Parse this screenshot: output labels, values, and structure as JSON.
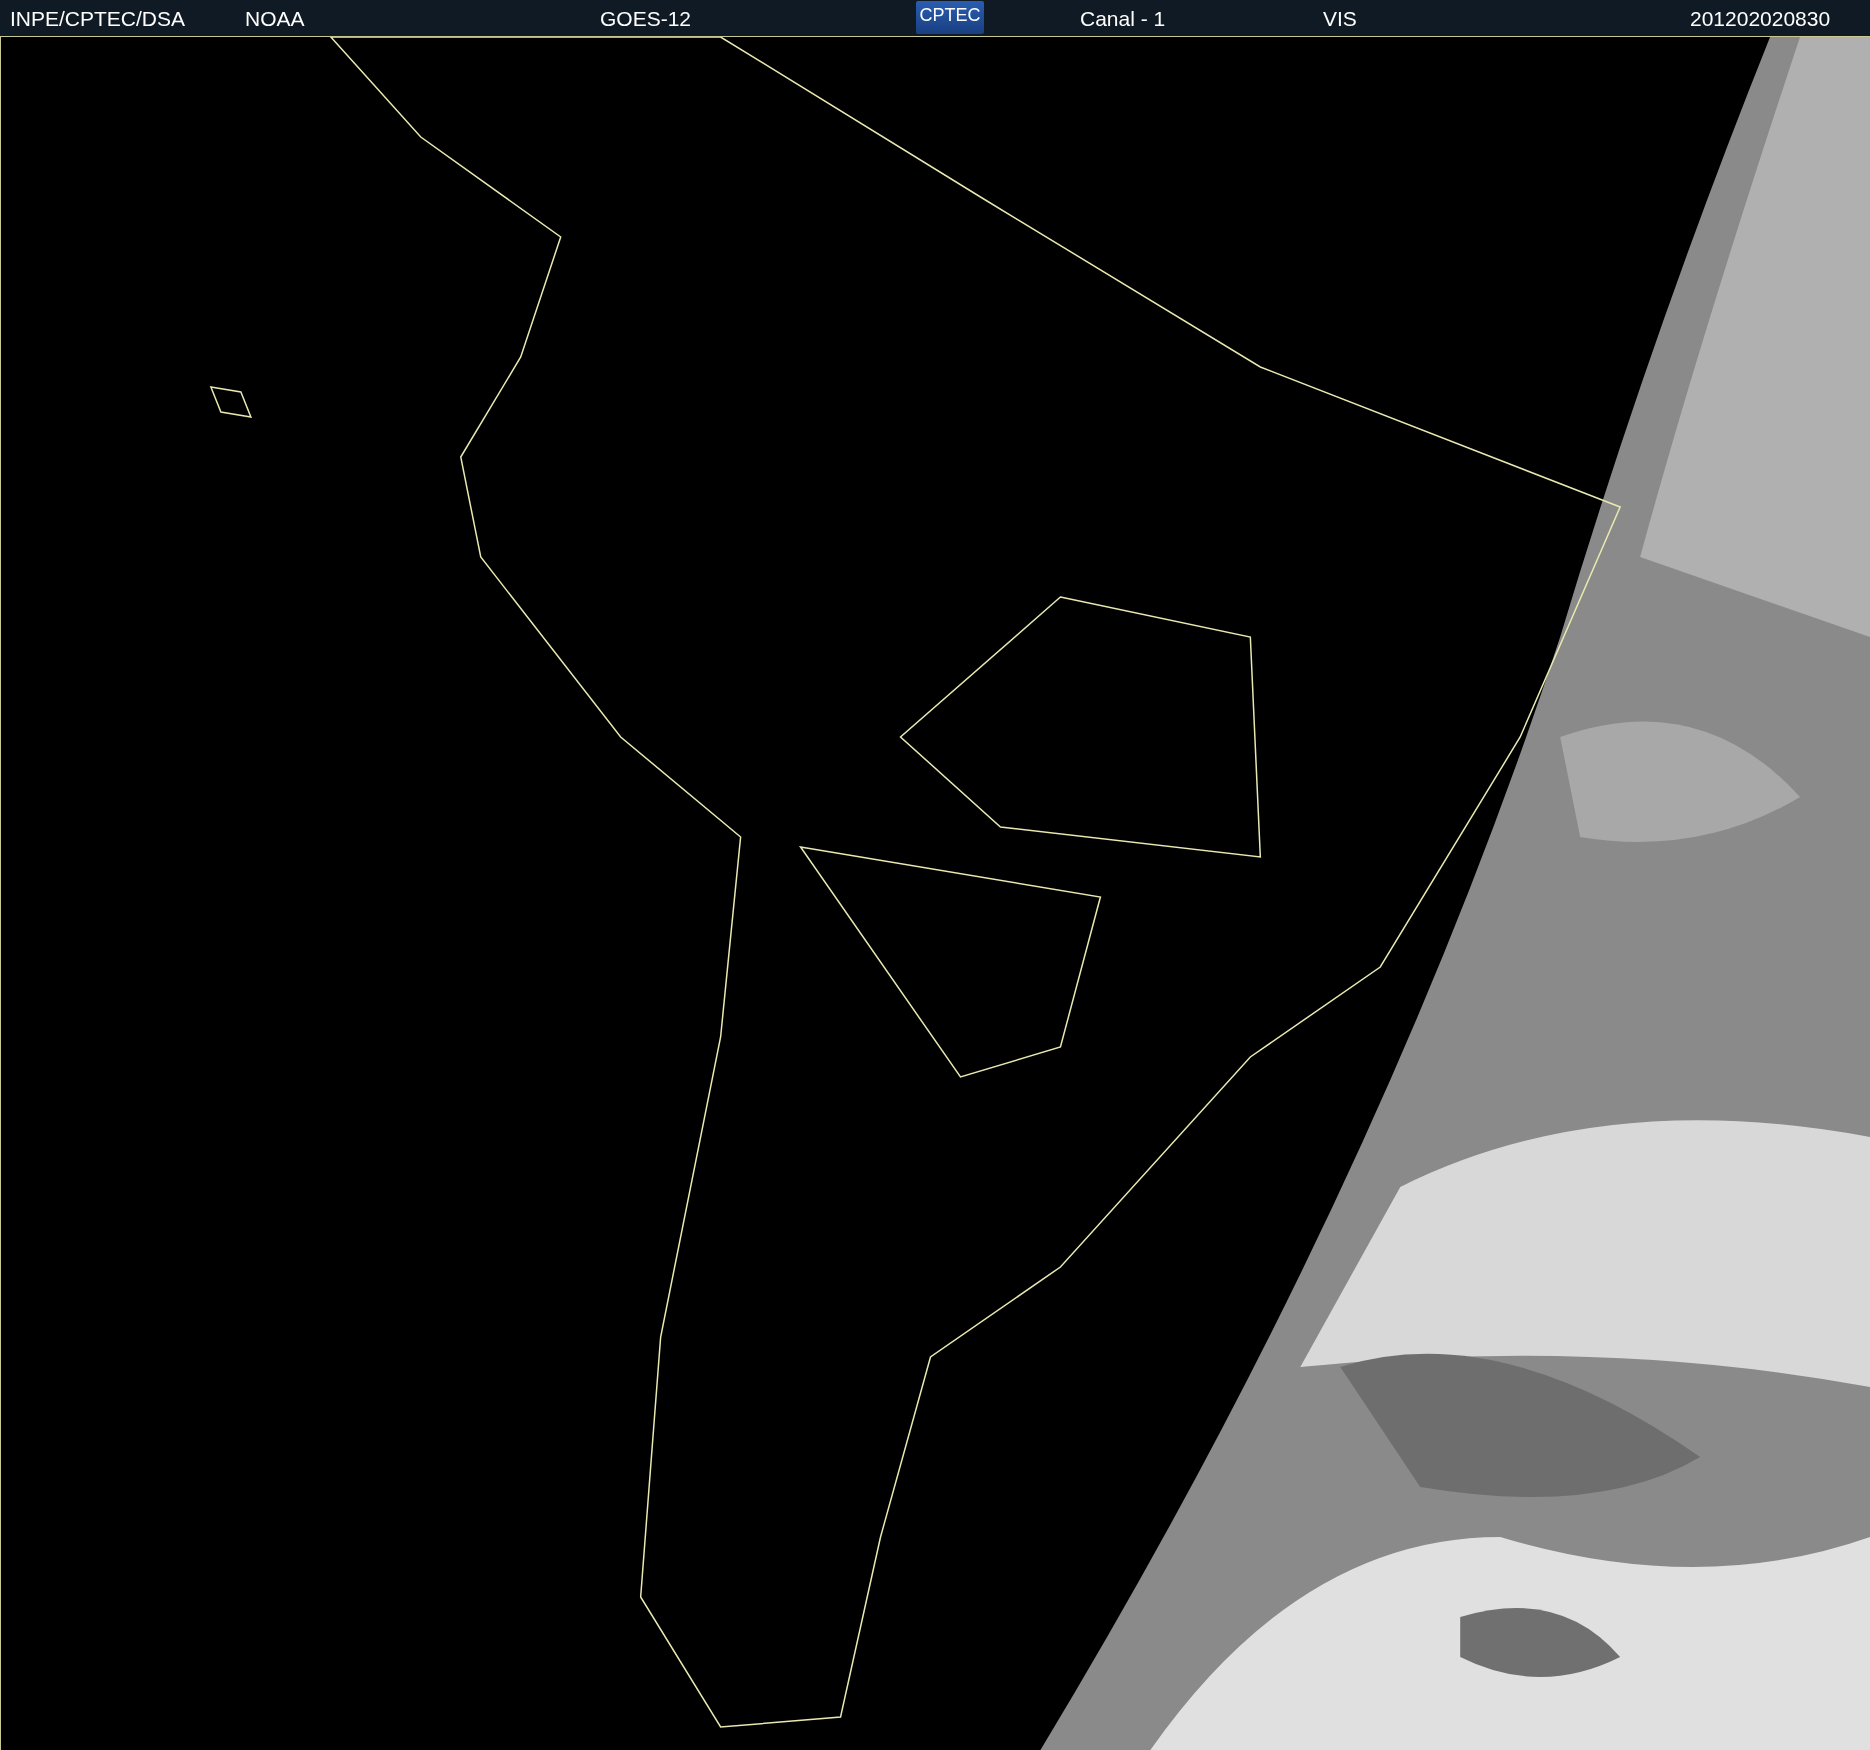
{
  "header": {
    "items": [
      {
        "kind": "text",
        "label": "INPE/CPTEC/DSA"
      },
      {
        "kind": "text",
        "label": "NOAA"
      },
      {
        "kind": "text",
        "label": "GOES-12"
      },
      {
        "kind": "logo",
        "label": "CPTEC"
      },
      {
        "kind": "text",
        "label": "Canal - 1"
      },
      {
        "kind": "text",
        "label": "VIS"
      },
      {
        "kind": "text",
        "label": "201202020830"
      }
    ]
  }
}
